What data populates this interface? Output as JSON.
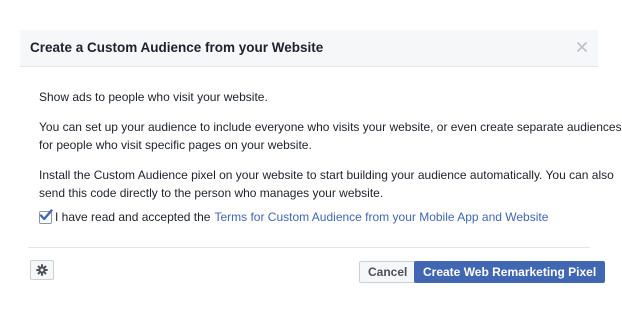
{
  "dialog": {
    "title": "Create a Custom Audience from your Website",
    "close_icon": "close-icon"
  },
  "body": {
    "paragraph1": "Show ads to people who visit your website.",
    "paragraph2_line1": "You can set up your audience to include everyone who visits your website, or even create separate audiences",
    "paragraph2_line2": "for people who visit specific pages on your website.",
    "paragraph3_line1": "Install the Custom Audience pixel on your website to start building your audience automatically. You can also",
    "paragraph3_line2": "send this code directly to the person who manages your website.",
    "consent": {
      "checked": true,
      "label": "I have read and accepted the",
      "link_text": "Terms for Custom Audience from your Mobile App and Website"
    }
  },
  "footer": {
    "settings_icon": "gear-icon",
    "cancel_label": "Cancel",
    "primary_label": "Create Web Remarketing Pixel"
  },
  "colors": {
    "primary": "#4267b2",
    "link": "#4267b2",
    "header_bg": "#f6f7f9",
    "text": "#1d2129"
  }
}
